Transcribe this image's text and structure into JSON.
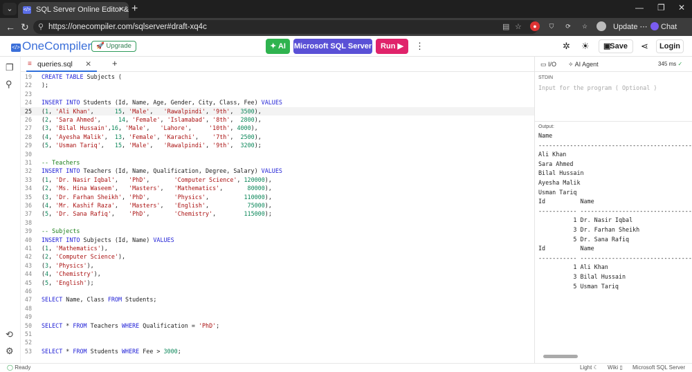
{
  "browser": {
    "tab_title": "SQL Server Online Editor & Compiler",
    "url": "https://onecompiler.com/sqlserver#draft-xq4c",
    "update_label": "Update",
    "chat_label": "Chat"
  },
  "header": {
    "logo_text": "OneCompiler",
    "logo_mark": "</>",
    "upgrade_label": "Upgrade",
    "ai_label": "AI",
    "language_label": "Microsoft SQL Server",
    "run_label": "Run",
    "save_label": "Save",
    "login_label": "Login"
  },
  "colors": {
    "brand": "#3b6fd9",
    "ai_button": "#2fb34f",
    "language_button": "#5a50d6",
    "run_button": "#e0236b"
  },
  "editor": {
    "file_name": "queries.sql",
    "add_label": "+",
    "active_line": "25",
    "lines": [
      {
        "n": "19",
        "t": "CREATE TABLE Subjects ("
      },
      {
        "n": "22",
        "t": ");"
      },
      {
        "n": "23",
        "t": ""
      },
      {
        "n": "24",
        "t": "INSERT INTO Students (Id, Name, Age, Gender, City, Class, Fee) VALUES"
      },
      {
        "n": "25",
        "t": "(1, 'Ali Khan',      15, 'Male',   'Rawalpindi', '9th',  3500),"
      },
      {
        "n": "26",
        "t": "(2, 'Sara Ahmed',     14, 'Female', 'Islamabad', '8th',  2800),"
      },
      {
        "n": "27",
        "t": "(3, 'Bilal Hussain',16, 'Male',   'Lahore',     '10th', 4000),"
      },
      {
        "n": "28",
        "t": "(4, 'Ayesha Malik',  13, 'Female', 'Karachi',    '7th',  2500),"
      },
      {
        "n": "29",
        "t": "(5, 'Usman Tariq',   15, 'Male',   'Rawalpindi', '9th',  3200);"
      },
      {
        "n": "30",
        "t": ""
      },
      {
        "n": "31",
        "t": "-- Teachers"
      },
      {
        "n": "32",
        "t": "INSERT INTO Teachers (Id, Name, Qualification, Degree, Salary) VALUES"
      },
      {
        "n": "33",
        "t": "(1, 'Dr. Nasir Iqbal',   'PhD',       'Computer Science', 120000),"
      },
      {
        "n": "34",
        "t": "(2, 'Ms. Hina Waseem',   'Masters',   'Mathematics',       80000),"
      },
      {
        "n": "35",
        "t": "(3, 'Dr. Farhan Sheikh', 'PhD',       'Physics',          110000),"
      },
      {
        "n": "36",
        "t": "(4, 'Mr. Kashif Raza',   'Masters',   'English',           75000),"
      },
      {
        "n": "37",
        "t": "(5, 'Dr. Sana Rafiq',    'PhD',       'Chemistry',        115000);"
      },
      {
        "n": "38",
        "t": ""
      },
      {
        "n": "39",
        "t": "-- Subjects"
      },
      {
        "n": "40",
        "t": "INSERT INTO Subjects (Id, Name) VALUES"
      },
      {
        "n": "41",
        "t": "(1, 'Mathematics'),"
      },
      {
        "n": "42",
        "t": "(2, 'Computer Science'),"
      },
      {
        "n": "43",
        "t": "(3, 'Physics'),"
      },
      {
        "n": "44",
        "t": "(4, 'Chemistry'),"
      },
      {
        "n": "45",
        "t": "(5, 'English');"
      },
      {
        "n": "46",
        "t": ""
      },
      {
        "n": "47",
        "t": "SELECT Name, Class FROM Students;"
      },
      {
        "n": "48",
        "t": ""
      },
      {
        "n": "49",
        "t": ""
      },
      {
        "n": "50",
        "t": "SELECT * FROM Teachers WHERE Qualification = 'PhD';"
      },
      {
        "n": "51",
        "t": ""
      },
      {
        "n": "52",
        "t": ""
      },
      {
        "n": "53",
        "t": "SELECT * FROM Students WHERE Fee > 3000;"
      }
    ]
  },
  "right_panel": {
    "io_tab": "I/O",
    "agent_tab": "AI Agent",
    "time": "345 ms",
    "stdin_label": "STDIN",
    "stdin_placeholder": "Input for the program ( Optional )",
    "output_label": "Output:",
    "output_lines": [
      "Name",
      "--------------------------------------------------",
      "Ali Khan",
      "Sara Ahmed",
      "Bilal Hussain",
      "Ayesha Malik",
      "Usman Tariq",
      "Id          Name",
      "----------- --------------------------------------",
      "          1 Dr. Nasir Iqbal",
      "          3 Dr. Farhan Sheikh",
      "          5 Dr. Sana Rafiq",
      "Id          Name",
      "----------- --------------------------------------",
      "          1 Ali Khan",
      "          3 Bilal Hussain",
      "          5 Usman Tariq"
    ]
  },
  "status": {
    "ready": "Ready",
    "theme": "Light",
    "wiki": "Wiki",
    "language": "Microsoft SQL Server"
  }
}
